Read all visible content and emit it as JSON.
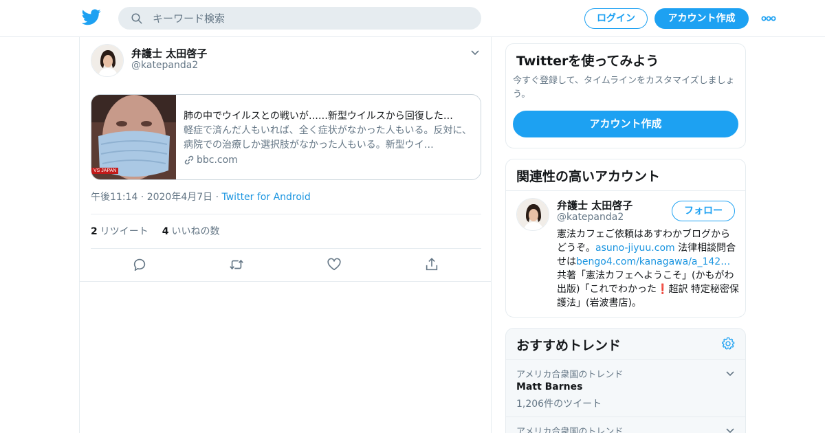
{
  "header": {
    "search_placeholder": "キーワード検索",
    "login_label": "ログイン",
    "signup_label": "アカウント作成"
  },
  "tweet": {
    "author_name": "弁護士 太田啓子",
    "author_handle": "@katepanda2",
    "card": {
      "title": "肺の中でウイルスとの戦いが……新型ウイルスから回復した…",
      "description": "軽症で済んだ人もいれば、全く症状がなかった人もいる。反対に、病院での治療しか選択肢がなかった人もいる。新型ウイ…",
      "domain": "bbc.com",
      "thumb_label": "VS JAPAN"
    },
    "timestamp": "午後11:14 · 2020年4月7日 ·",
    "source": "Twitter for Android",
    "retweet_count": "2",
    "retweet_label": "リツイート",
    "like_count": "4",
    "like_label": "いいねの数"
  },
  "sidebar": {
    "try": {
      "title": "Twitterを使ってみよう",
      "description": "今すぐ登録して、タイムラインをカスタマイズしましょう。",
      "signup_label": "アカウント作成"
    },
    "related": {
      "title": "関連性の高いアカウント",
      "account": {
        "name": "弁護士 太田啓子",
        "handle": "@katepanda2",
        "follow_label": "フォロー",
        "bio_1": "憲法カフェご依頼はあすわかブログからどうぞ。",
        "bio_link_1": "asuno-jiyuu.com",
        "bio_2": " 法律相談問合せは",
        "bio_link_2": "bengo4.com/kanagawa/a_142…",
        "bio_3": " 共著「憲法カフェへようこそ」(かもがわ出版)「これでわかった",
        "bio_emoji": "❗",
        "bio_4": "超訳 特定秘密保護法」(岩波書店)。"
      }
    },
    "trends": {
      "title": "おすすめトレンド",
      "items": [
        {
          "context": "アメリカ合衆国のトレンド",
          "name": "Matt Barnes",
          "count": "1,206件のツイート"
        },
        {
          "context": "アメリカ合衆国のトレンド"
        }
      ]
    }
  },
  "colors": {
    "accent": "#1da1f2",
    "link": "#1b95e0",
    "text": "#14171a",
    "secondary": "#657786",
    "border": "#e6ecf0"
  }
}
